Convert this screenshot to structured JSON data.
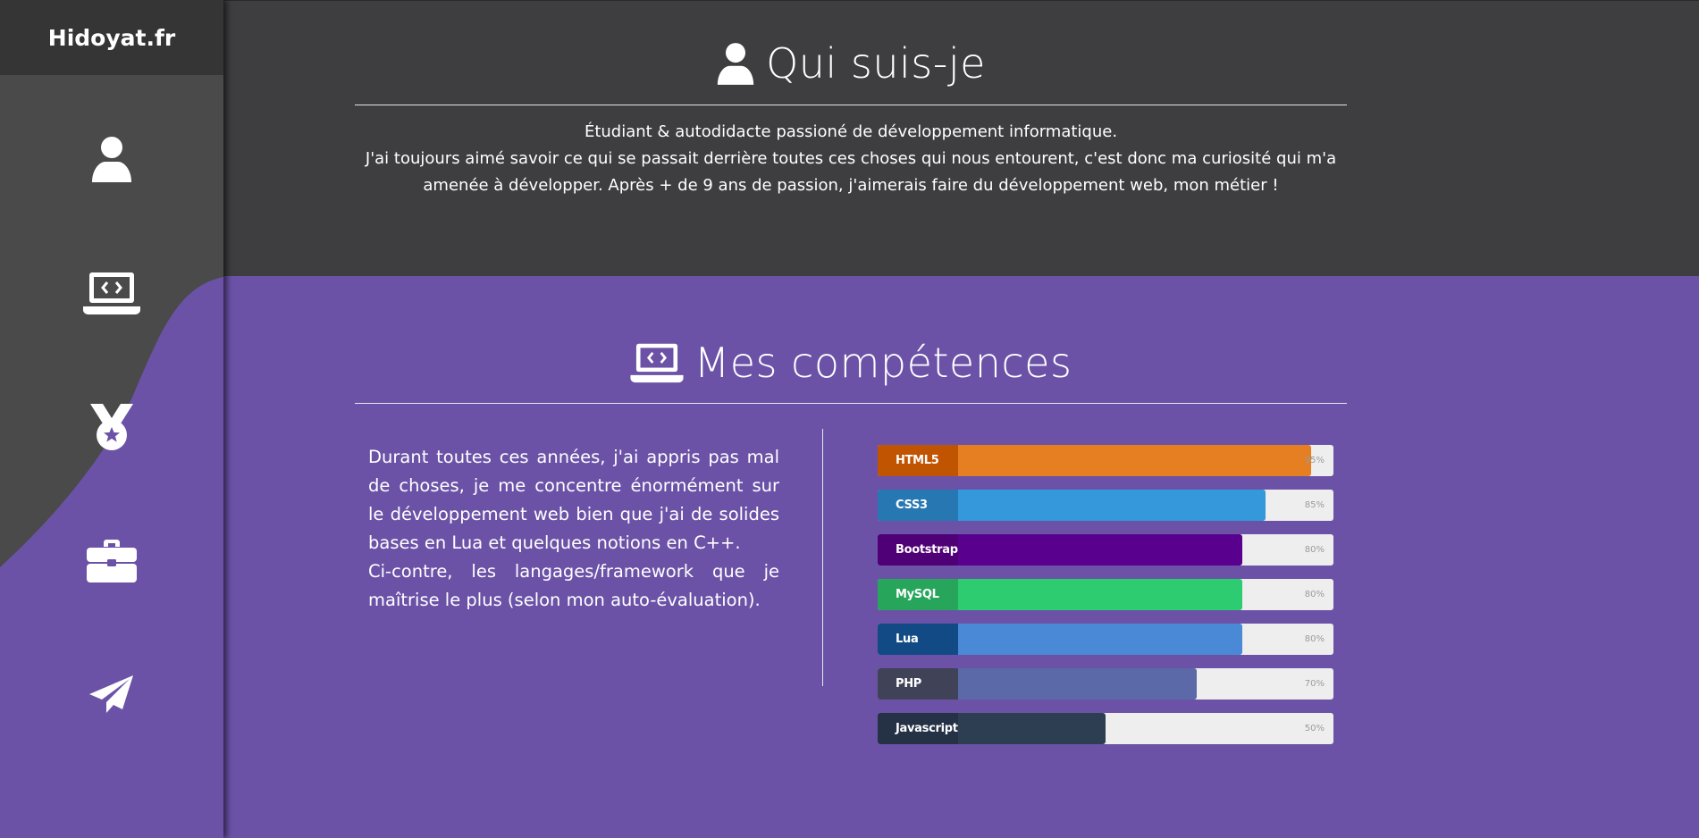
{
  "sidebar": {
    "brand": "Hidoyat.fr",
    "colors": {
      "background": "#4a4a4a",
      "brand_background": "#353535",
      "wave": "#6b52a7"
    },
    "items": [
      {
        "name": "about",
        "icon": "user-icon"
      },
      {
        "name": "skills",
        "icon": "laptop-code-icon"
      },
      {
        "name": "awards",
        "icon": "medal-icon"
      },
      {
        "name": "experience",
        "icon": "briefcase-icon"
      },
      {
        "name": "contact",
        "icon": "paper-plane-icon"
      }
    ]
  },
  "about": {
    "title": "Qui suis-je",
    "icon": "user-icon",
    "line1": "Étudiant & autodidacte passioné de développement informatique.",
    "line2": "J'ai toujours aimé savoir ce qui se passait derrière toutes ces choses qui nous entourent, c'est donc ma curiosité qui m'a amenée à développer. Après + de 9 ans de passion, j'aimerais faire du développement web, mon métier !"
  },
  "skills": {
    "title": "Mes compétences",
    "icon": "laptop-code-icon",
    "text1": "Durant toutes ces années, j'ai appris pas mal de choses, je me concentre énormément sur le développement web bien que j'ai de solides bases en Lua et quelques notions en C++.",
    "text2": "Ci-contre, les langages/framework que je maîtrise le plus (selon mon auto-évaluation).",
    "bars": [
      {
        "label": "HTML5",
        "percent": 95,
        "percent_text": "95%",
        "label_color": "#c15400",
        "fill_color": "#e67e22"
      },
      {
        "label": "CSS3",
        "percent": 85,
        "percent_text": "85%",
        "label_color": "#2677b2",
        "fill_color": "#3498db"
      },
      {
        "label": "Bootstrap",
        "percent": 80,
        "percent_text": "80%",
        "label_color": "#4f0076",
        "fill_color": "#5a008f"
      },
      {
        "label": "MySQL",
        "percent": 80,
        "percent_text": "80%",
        "label_color": "#27a65b",
        "fill_color": "#2ecc71"
      },
      {
        "label": "Lua",
        "percent": 80,
        "percent_text": "80%",
        "label_color": "#124a85",
        "fill_color": "#4a89d6"
      },
      {
        "label": "PHP",
        "percent": 70,
        "percent_text": "70%",
        "label_color": "#404258",
        "fill_color": "#5b69a8"
      },
      {
        "label": "Javascript",
        "percent": 50,
        "percent_text": "50%",
        "label_color": "#253245",
        "fill_color": "#2d3e53"
      }
    ]
  },
  "colors": {
    "top_background": "#3e3e40",
    "bottom_background": "#6b52a7",
    "bar_track": "#eeeeee"
  }
}
